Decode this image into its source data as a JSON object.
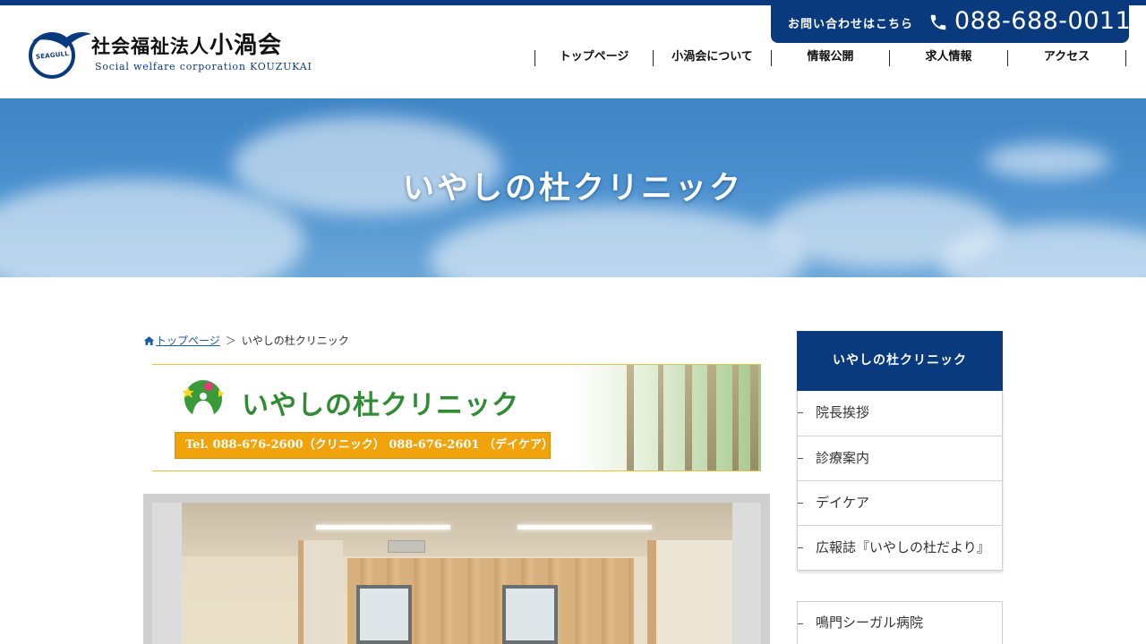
{
  "site": {
    "logo_mark_text": "SEAGULL",
    "logo_prefix": "社会福祉法人",
    "logo_name": "小渦会",
    "logo_sub": "Social welfare corporation KOUZUKAI"
  },
  "contact": {
    "label": "お問い合わせはこちら",
    "phone": "088-688-0011"
  },
  "nav": {
    "items": [
      "トップページ",
      "小渦会について",
      "情報公開",
      "求人情報",
      "アクセス"
    ]
  },
  "hero": {
    "title": "いやしの杜クリニック"
  },
  "breadcrumb": {
    "home": "トップページ",
    "separator": "＞",
    "current": "いやしの杜クリニック"
  },
  "banner": {
    "name": "いやしの杜クリニック",
    "tel": "Tel. 088-676-2600（クリニック） 088-676-2601 （デイケア）"
  },
  "sidebar": {
    "heading": "いやしの杜クリニック",
    "items": [
      "院長挨拶",
      "診療案内",
      "デイケア",
      "広報誌『いやしの杜だより』"
    ],
    "second_items": [
      "鳴門シーガル病院"
    ]
  },
  "colors": {
    "brand": "#0a3a7e",
    "banner_tel": "#f0a30a",
    "banner_name": "#2f8c33"
  },
  "icons": {
    "phone": "phone-icon",
    "home": "home-icon",
    "logo": "seagull-logo-icon"
  }
}
